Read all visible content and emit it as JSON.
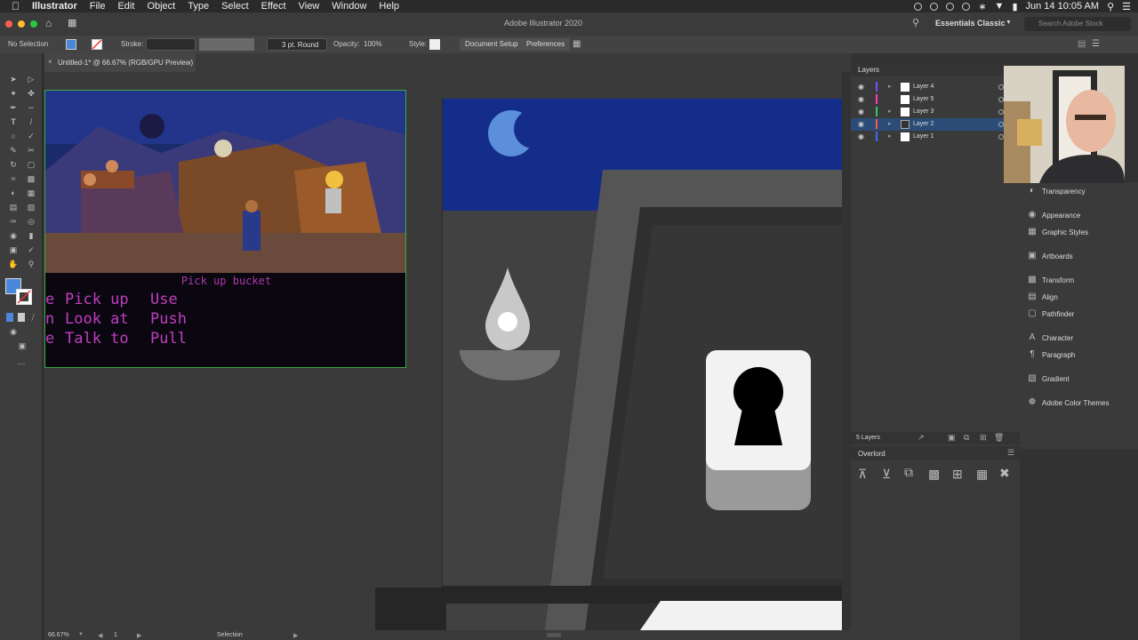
{
  "menubar": {
    "app": "Illustrator",
    "items": [
      "File",
      "Edit",
      "Object",
      "Type",
      "Select",
      "Effect",
      "View",
      "Window",
      "Help"
    ],
    "clock": "Jun 14  10:05 AM"
  },
  "titlebar": {
    "title": "Adobe Illustrator 2020",
    "workspace": "Essentials Classic",
    "search_placeholder": "Search Adobe Stock"
  },
  "control": {
    "selection": "No Selection",
    "stroke_label": "Stroke:",
    "brush": "3 pt. Round",
    "opacity_label": "Opacity:",
    "opacity_value": "100%",
    "style_label": "Style:",
    "doc_setup": "Document Setup",
    "preferences": "Preferences"
  },
  "document": {
    "tab_title": "Untitled-1* @ 66.67% (RGB/GPU Preview)"
  },
  "game": {
    "sentence": "Pick up bucket",
    "verbs_col1": [
      "Pick up",
      "Look at",
      "Talk to"
    ],
    "verbs_col2": [
      "Use",
      "Push",
      "Pull"
    ],
    "verbs_col0": [
      "e",
      "n",
      "e"
    ]
  },
  "layers": {
    "title": "Layers",
    "items": [
      {
        "name": "Layer 4",
        "color": "#7a4cff"
      },
      {
        "name": "Layer 5",
        "color": "#ff3db8"
      },
      {
        "name": "Layer 3",
        "color": "#34c46a"
      },
      {
        "name": "Layer 2",
        "color": "#ff5555"
      },
      {
        "name": "Layer 1",
        "color": "#3b6bff"
      }
    ],
    "selected": "Layer 2",
    "count": "5 Layers"
  },
  "dock": {
    "items": [
      "Transparency",
      "Appearance",
      "Graphic Styles",
      "Artboards",
      "Transform",
      "Align",
      "Pathfinder",
      "Character",
      "Paragraph",
      "Gradient",
      "Adobe Color Themes"
    ]
  },
  "overlord": {
    "title": "Overlord"
  },
  "status": {
    "zoom": "66.67%",
    "artboard": "1",
    "tool": "Selection"
  }
}
